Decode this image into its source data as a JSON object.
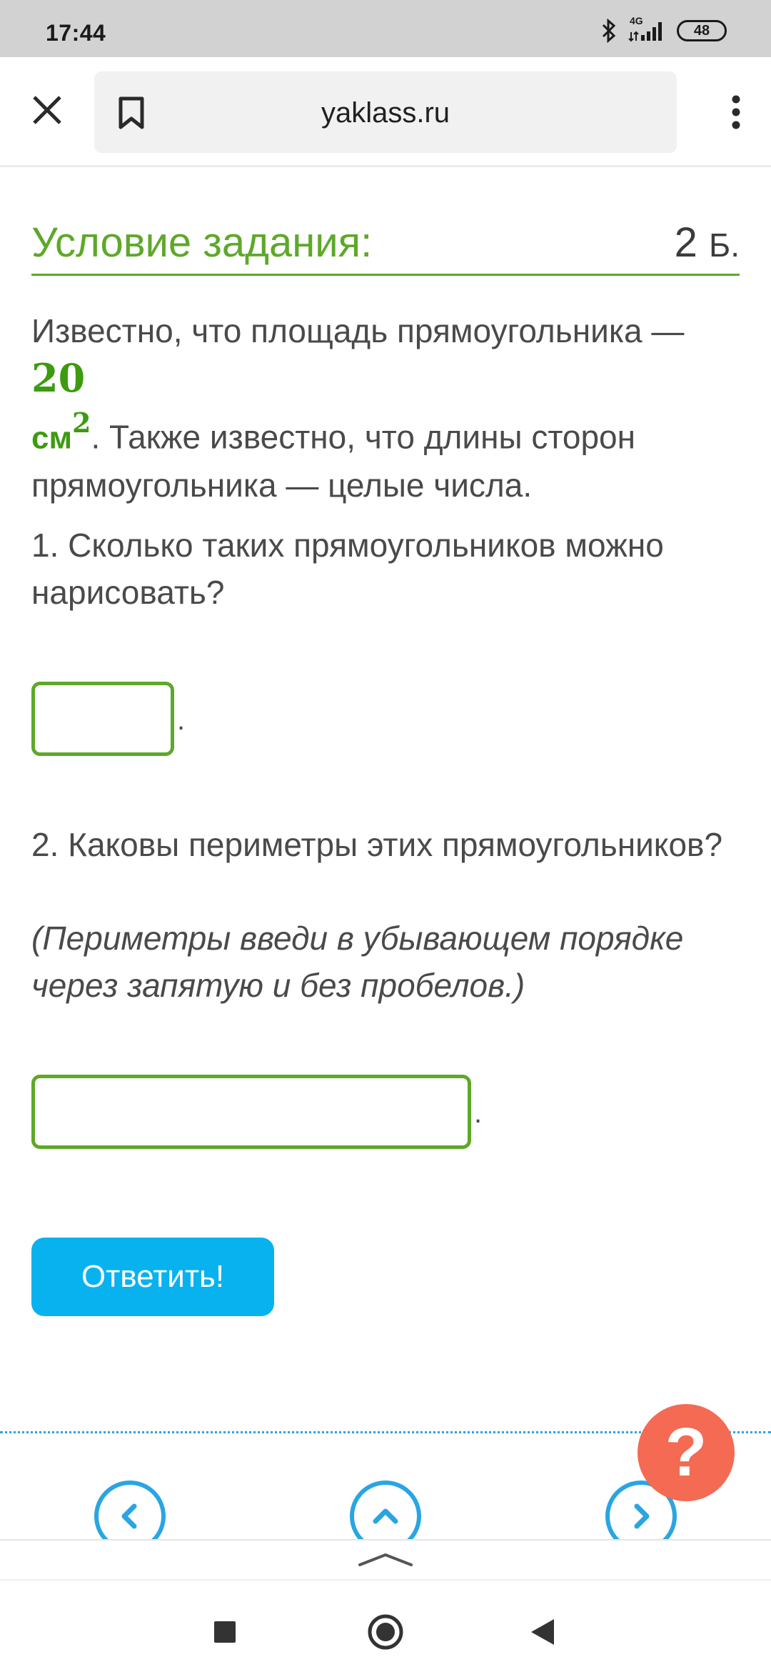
{
  "status_bar": {
    "time": "17:44",
    "network": "4G",
    "battery": "48",
    "icons": [
      "bluetooth-icon",
      "signal-icon",
      "battery-icon"
    ]
  },
  "browser": {
    "url": "yaklass.ru",
    "icons": [
      "close-icon",
      "bookmark-icon",
      "more-vert-icon"
    ]
  },
  "task": {
    "title": "Условие задания:",
    "points_value": "2",
    "points_unit": "Б.",
    "intro_part1": "Известно, что площадь прямоугольника — ",
    "area_value": "20",
    "area_unit": "см",
    "area_exp": "2",
    "intro_part2": ". Также известно, что длины сторон прямоугольника — целые числа.",
    "question1": "1. Сколько таких прямоугольников можно нарисовать?",
    "answer1_value": "",
    "answer1_suffix": ".",
    "question2": "2. Каковы периметры этих прямоугольников?",
    "hint": "(Периметры введи в убывающем порядке через запятую и без пробелов.)",
    "answer2_value": "",
    "answer2_suffix": ".",
    "submit_label": "Ответить!"
  },
  "footer": {
    "help_label": "?",
    "nav_icons": [
      "chevron-left-icon",
      "chevron-up-icon",
      "chevron-right-icon"
    ]
  },
  "colors": {
    "accent_green": "#5ea82a",
    "button_blue": "#08b2ef",
    "help_red": "#f46a52",
    "nav_blue": "#29a5e3"
  }
}
